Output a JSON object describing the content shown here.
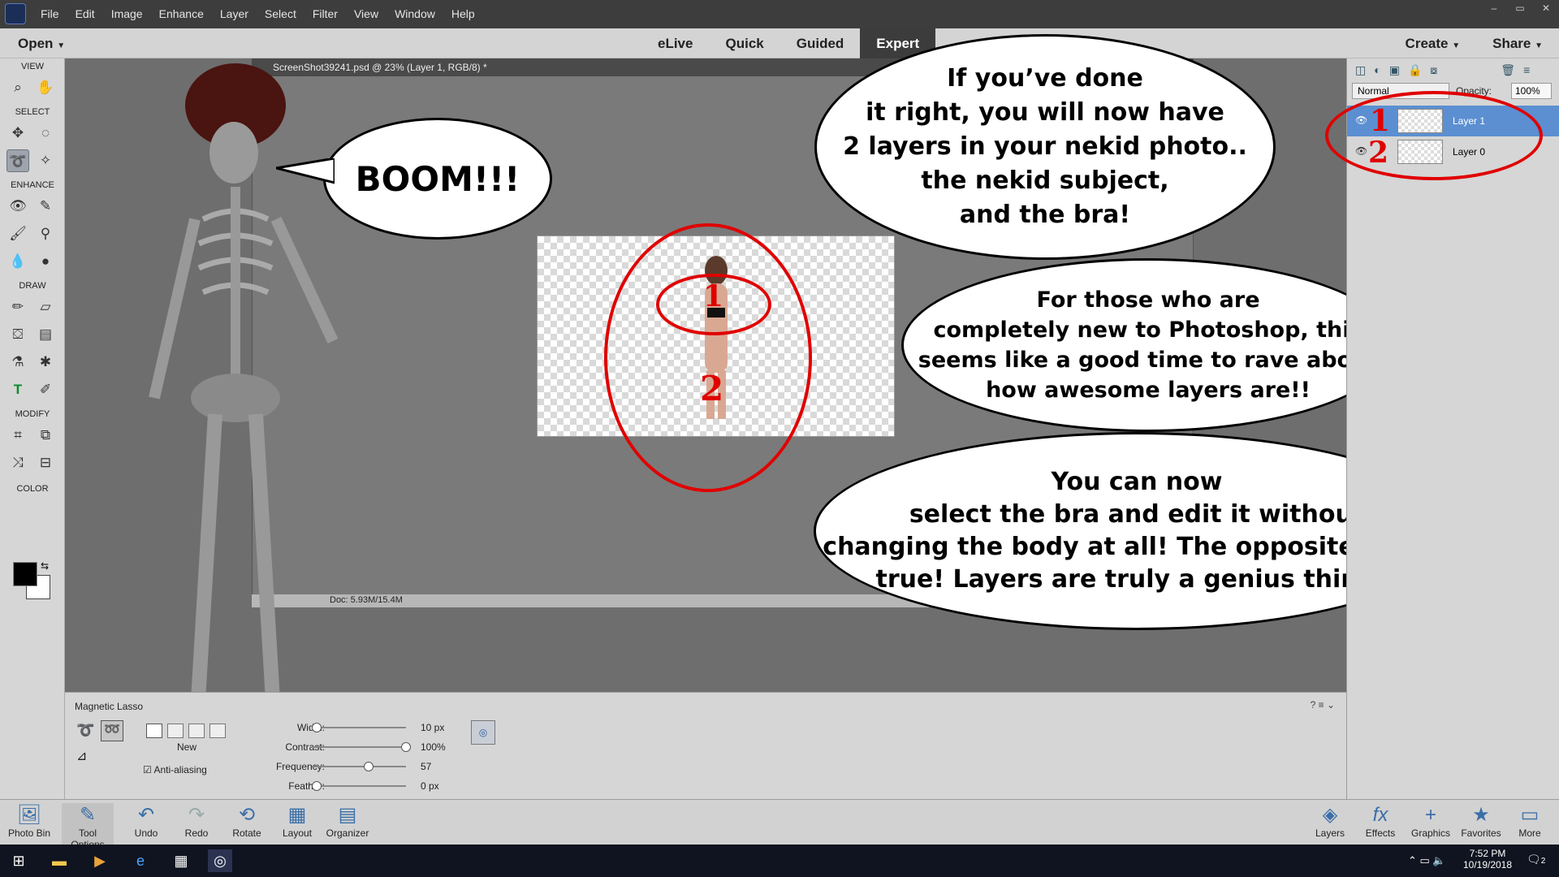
{
  "menubar": {
    "items": [
      "File",
      "Edit",
      "Image",
      "Enhance",
      "Layer",
      "Select",
      "Filter",
      "View",
      "Window",
      "Help"
    ],
    "window_buttons": [
      "–",
      "▭",
      "✕"
    ]
  },
  "modebar": {
    "open": "Open",
    "tabs": [
      "eLive",
      "Quick",
      "Guided",
      "Expert"
    ],
    "active_tab": "Expert",
    "create": "Create",
    "share": "Share"
  },
  "toolbox": {
    "sections": [
      "VIEW",
      "SELECT",
      "ENHANCE",
      "DRAW",
      "MODIFY",
      "COLOR"
    ]
  },
  "document": {
    "tab_title": "ScreenShot39241.psd @ 23% (Layer 1, RGB/8) *",
    "status": "Doc: 5.93M/15.4M"
  },
  "layers_panel": {
    "blend_mode": "Normal",
    "opacity_label": "Opacity:",
    "opacity_value": "100%",
    "layers": [
      {
        "name": "Layer 1",
        "selected": true
      },
      {
        "name": "Layer 0",
        "selected": false
      }
    ]
  },
  "tool_options": {
    "tool_name": "Magnetic Lasso",
    "new_label": "New",
    "anti_aliasing": "Anti-aliasing",
    "width_label": "Width:",
    "width_value": "10 px",
    "contrast_label": "Contrast:",
    "contrast_value": "100%",
    "frequency_label": "Frequency:",
    "frequency_value": "57",
    "feather_label": "Feather:",
    "feather_value": "0 px"
  },
  "bottom_bar": {
    "left": [
      "Photo Bin",
      "Tool Options",
      "Undo",
      "Redo",
      "Rotate",
      "Layout",
      "Organizer"
    ],
    "right": [
      "Layers",
      "Effects",
      "Graphics",
      "Favorites",
      "More"
    ]
  },
  "taskbar": {
    "time": "7:52 PM",
    "date": "10/19/2018",
    "notifications": "2"
  },
  "annotations": {
    "boom": "BOOM!!!",
    "bubble1": "If you’ve done\nit right, you will now have\n2 layers in your nekid photo..\nthe nekid subject,\nand the bra!",
    "bubble2": "For those who are\ncompletely new to Photoshop, this\nseems like a good time to rave about\nhow awesome layers are!!",
    "bubble3": "You can now\nselect the bra and edit it without\nchanging the body at all! The opposite is also\ntrue! Layers are truly a genius thing!!",
    "num1": "1",
    "num2": "2"
  },
  "colors": {
    "annotation_red": "#e00000",
    "layer_selected": "#5b8fd1"
  }
}
